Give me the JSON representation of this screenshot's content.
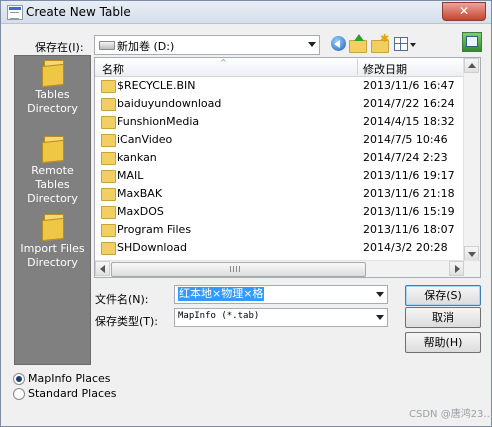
{
  "window": {
    "title": "Create New Table",
    "close_glyph": "✕"
  },
  "toolbar": {
    "look_in_label": "保存在(I):",
    "look_in_value": "新加卷 (D:)",
    "icons": [
      "back-icon",
      "up-folder-icon",
      "new-folder-icon",
      "view-menu-icon",
      "help-icon"
    ]
  },
  "places": [
    {
      "label": "Tables Directory"
    },
    {
      "label": "Remote Tables Directory"
    },
    {
      "label": "Import Files Directory"
    }
  ],
  "file_list": {
    "columns": {
      "name": "名称",
      "date": "修改日期"
    },
    "sort_indicator": "^",
    "grip": "ııı",
    "rows": [
      {
        "name": "$RECYCLE.BIN",
        "date": "2013/11/6 16:47"
      },
      {
        "name": "baiduyundownload",
        "date": "2014/7/22 16:24"
      },
      {
        "name": "FunshionMedia",
        "date": "2014/4/15 18:32"
      },
      {
        "name": "iCanVideo",
        "date": "2014/7/5 10:46"
      },
      {
        "name": "kankan",
        "date": "2014/7/24 2:23"
      },
      {
        "name": "MAIL",
        "date": "2013/11/6 19:17"
      },
      {
        "name": "MaxBAK",
        "date": "2013/11/6 21:18"
      },
      {
        "name": "MaxDOS",
        "date": "2013/11/6 15:19"
      },
      {
        "name": "Program Files",
        "date": "2013/11/6 18:07"
      },
      {
        "name": "SHDownload",
        "date": "2014/3/2 20:28"
      }
    ]
  },
  "filename": {
    "label": "文件名(N):",
    "value": "红本地×物理×格"
  },
  "filetype": {
    "label": "保存类型(T):",
    "value": "MapInfo (*.tab)"
  },
  "buttons": {
    "save": "保存(S)",
    "cancel": "取消",
    "help": "帮助(H)"
  },
  "place_options": {
    "mapinfo": "MapInfo Places",
    "standard": "Standard Places",
    "selected": "mapinfo"
  },
  "watermark": "CSDN @唐鸿23..."
}
